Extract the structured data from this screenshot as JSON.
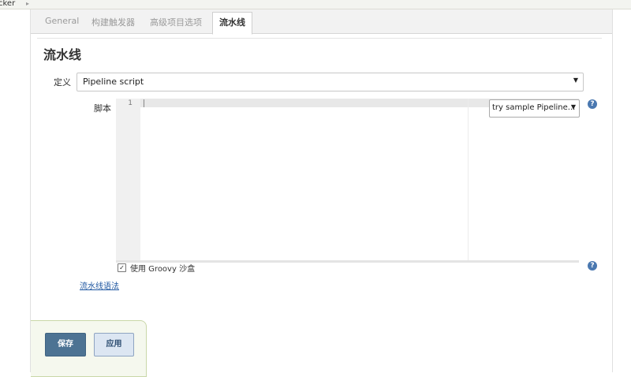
{
  "breadcrumb": {
    "item": "cker",
    "separator": "▸"
  },
  "tabs": [
    {
      "label": "General"
    },
    {
      "label": "构建触发器"
    },
    {
      "label": "高级项目选项"
    },
    {
      "label": "流水线"
    }
  ],
  "section": {
    "title": "流水线"
  },
  "definition": {
    "label": "定义",
    "value": "Pipeline script"
  },
  "script": {
    "label": "脚本",
    "line_number": "1",
    "sample_select_value": "try sample Pipeline..."
  },
  "groovy_sandbox": {
    "label": "使用 Groovy 沙盒",
    "checked": true
  },
  "syntax_link": "流水线语法",
  "buttons": {
    "save": "保存",
    "apply": "应用"
  },
  "colors": {
    "accent": "#4d7393",
    "link": "#1f57a1",
    "help_icon": "#4a78b0"
  }
}
